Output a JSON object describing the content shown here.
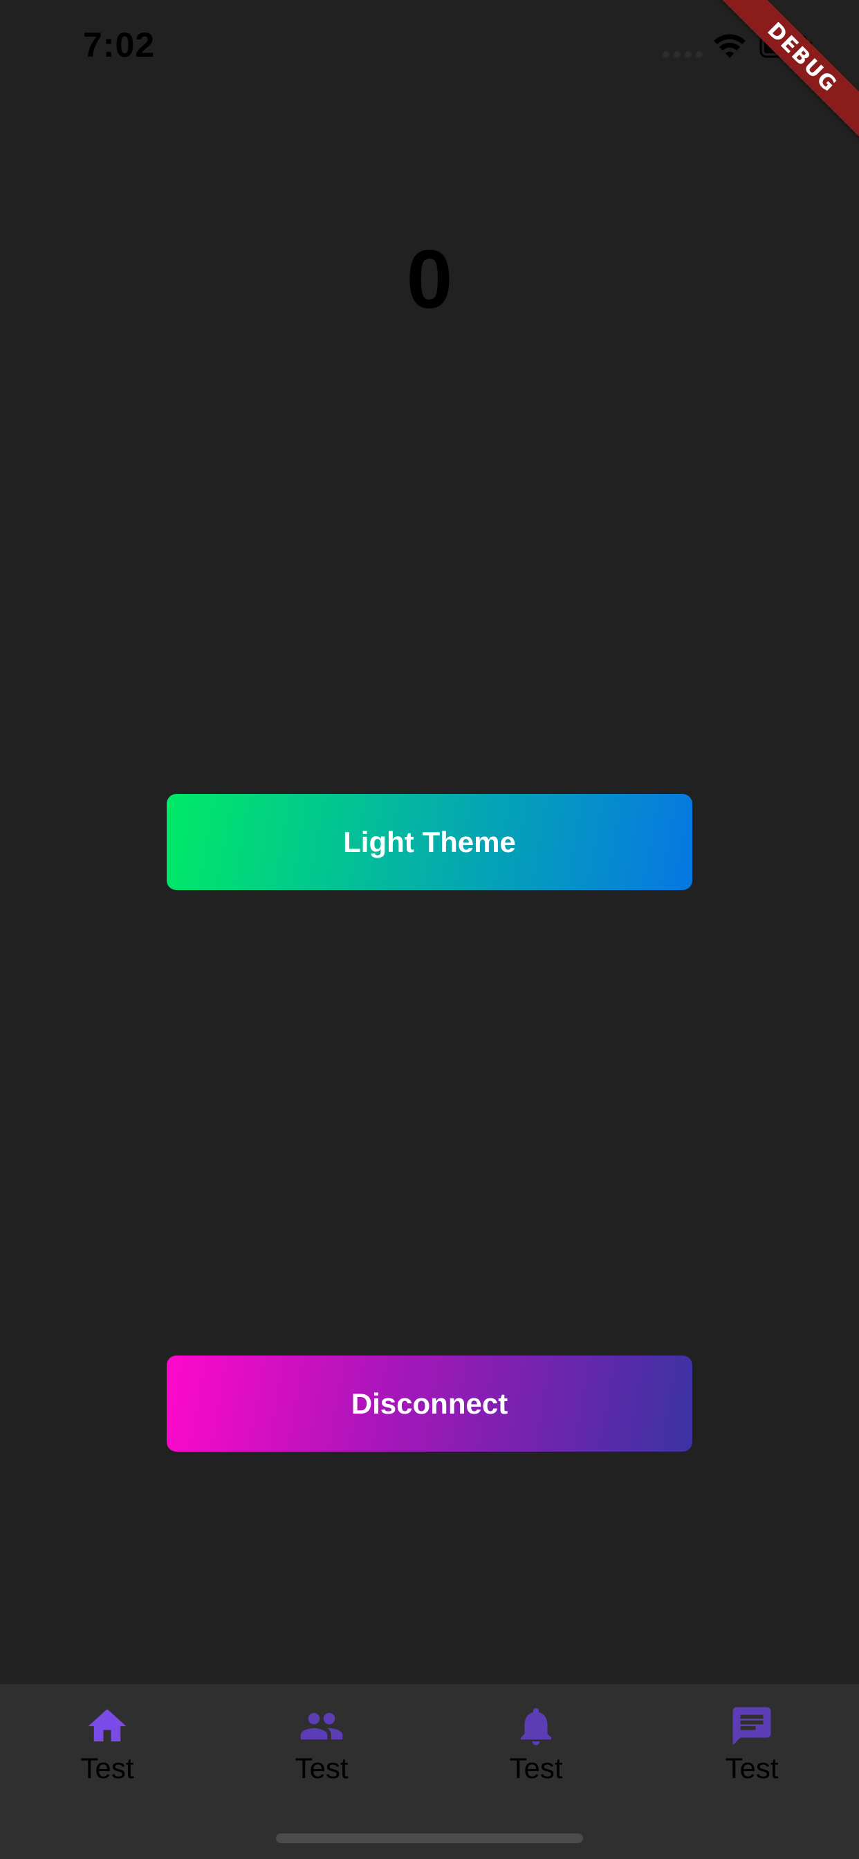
{
  "status_bar": {
    "time": "7:02",
    "icons": [
      "signal-icon",
      "wifi-icon",
      "battery-icon"
    ]
  },
  "debug_banner": {
    "label": "DEBUG",
    "color": "#8b1c1c"
  },
  "counter": {
    "value": "0"
  },
  "buttons": {
    "light_theme": {
      "label": "Light Theme",
      "gradient": [
        "#00ea66",
        "#04b0a8",
        "#0677e3"
      ]
    },
    "disconnect": {
      "label": "Disconnect",
      "gradient": [
        "#ff08cc",
        "#a217b9",
        "#3a33a3"
      ]
    }
  },
  "bottom_nav": {
    "items": [
      {
        "label": "Test",
        "icon": "home-icon",
        "color": "#7b4be8",
        "active": true
      },
      {
        "label": "Test",
        "icon": "people-icon",
        "color": "#5d3db5",
        "active": false
      },
      {
        "label": "Test",
        "icon": "bell-icon",
        "color": "#5d3db5",
        "active": false
      },
      {
        "label": "Test",
        "icon": "chat-icon",
        "color": "#5d3db5",
        "active": false
      }
    ]
  },
  "colors": {
    "background": "#212121",
    "nav_background": "#2f2f2f",
    "accent": "#7b4be8"
  }
}
